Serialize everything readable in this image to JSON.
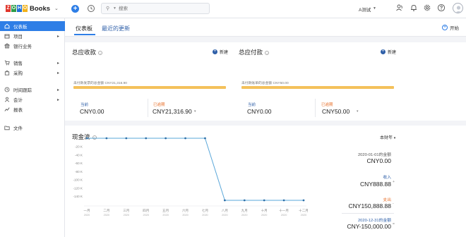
{
  "app": {
    "name": "Books",
    "org_name": "A测试"
  },
  "search": {
    "placeholder": "搜索"
  },
  "sidebar": {
    "items": [
      {
        "label": "仪表板",
        "icon": "home-icon",
        "active": true,
        "has_children": false
      },
      {
        "label": "项目",
        "icon": "box-icon",
        "active": false,
        "has_children": true
      },
      {
        "label": "银行业务",
        "icon": "bank-icon",
        "active": false,
        "has_children": false
      },
      {
        "label": "销售",
        "icon": "cart-icon",
        "active": false,
        "has_children": true
      },
      {
        "label": "采购",
        "icon": "bag-icon",
        "active": false,
        "has_children": true
      },
      {
        "label": "时间跟踪",
        "icon": "clock-icon",
        "active": false,
        "has_children": true
      },
      {
        "label": "会计",
        "icon": "person-icon",
        "active": false,
        "has_children": true
      },
      {
        "label": "报表",
        "icon": "chart-icon",
        "active": false,
        "has_children": false
      },
      {
        "label": "文件",
        "icon": "folder-icon",
        "active": false,
        "has_children": false
      }
    ]
  },
  "tabs": [
    {
      "label": "仪表板",
      "active": true
    },
    {
      "label": "最近的更新",
      "active": false
    }
  ],
  "start_label": "开始",
  "receivables": {
    "title": "总应收款",
    "new_label": "新建",
    "subtitle": "未付款发票的总金额 CNY21,316.90",
    "current_label": "当前",
    "overdue_label": "已逾期",
    "current_value": "CNY0.00",
    "overdue_value": "CNY21,316.90",
    "overdue_fraction": 1.0
  },
  "payables": {
    "title": "总应付款",
    "new_label": "新建",
    "subtitle": "未付款账单的总金额 CNY50.00",
    "current_label": "当前",
    "overdue_label": "已逾期",
    "current_value": "CNY0.00",
    "overdue_value": "CNY50.00",
    "overdue_fraction": 1.0
  },
  "cashflow": {
    "title": "现金流",
    "period": "本财年",
    "opening_label": "2020-01-01的金额",
    "opening_value": "CNY0.00",
    "incoming_label": "收入",
    "incoming_value": "CNY888.88",
    "outgoing_label": "支出",
    "outgoing_value": "CNY150,888.88",
    "closing_label": "2020-12-31的金额",
    "closing_value": "CNY-150,000.00"
  },
  "colors": {
    "accent": "#2e7ee6",
    "bar": "#f4c15b",
    "orange": "#e8702a",
    "line": "#5aa7d9"
  },
  "chart_data": {
    "type": "line",
    "title": "现金流",
    "categories": [
      "一月",
      "二月",
      "三月",
      "四月",
      "五月",
      "六月",
      "七月",
      "八月",
      "九月",
      "十月",
      "十一月",
      "十二月"
    ],
    "category_sublabels": [
      "2020",
      "2020",
      "2020",
      "2020",
      "2020",
      "2020",
      "2020",
      "2020",
      "2020",
      "2020",
      "2020",
      "2020"
    ],
    "series": [
      {
        "values": [
          0,
          0,
          0,
          0,
          0,
          0,
          0,
          -150000,
          -150000,
          -150000,
          -150000,
          -150000
        ]
      }
    ],
    "y_ticks": [
      "0",
      "-20 K",
      "-40 K",
      "-60 K",
      "-80 K",
      "-100 K",
      "-120 K",
      "-140 K"
    ],
    "y_tick_values": [
      0,
      -20000,
      -40000,
      -60000,
      -80000,
      -100000,
      -120000,
      -140000
    ],
    "ylim": [
      -150000,
      0
    ],
    "grid": false,
    "xlabel": "",
    "ylabel": ""
  }
}
